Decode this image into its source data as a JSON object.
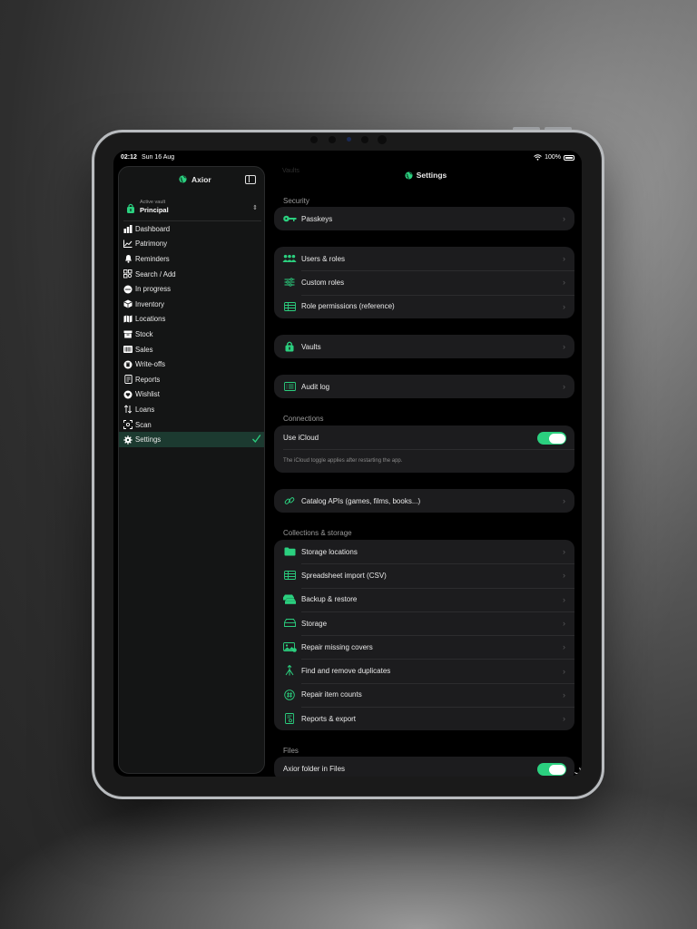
{
  "status_bar": {
    "time": "02:12",
    "date": "Sun 16 Aug",
    "battery": "100%"
  },
  "sidebar": {
    "app_title": "Axior",
    "active_vault_label": "Active vault",
    "active_vault_name": "Principal",
    "items": [
      {
        "label": "Dashboard",
        "icon": "bar-chart-icon"
      },
      {
        "label": "Patrimony",
        "icon": "trend-chart-icon"
      },
      {
        "label": "Reminders",
        "icon": "bell-icon"
      },
      {
        "label": "Search / Add",
        "icon": "grid-search-icon"
      },
      {
        "label": "In progress",
        "icon": "progress-dots-icon"
      },
      {
        "label": "Inventory",
        "icon": "cube-icon"
      },
      {
        "label": "Locations",
        "icon": "map-icon"
      },
      {
        "label": "Stock",
        "icon": "archive-box-icon"
      },
      {
        "label": "Sales",
        "icon": "barcode-icon"
      },
      {
        "label": "Write-offs",
        "icon": "trash-circle-icon"
      },
      {
        "label": "Reports",
        "icon": "document-icon"
      },
      {
        "label": "Wishlist",
        "icon": "heart-circle-icon"
      },
      {
        "label": "Loans",
        "icon": "swap-arrows-icon"
      },
      {
        "label": "Scan",
        "icon": "scan-viewfinder-icon"
      },
      {
        "label": "Settings",
        "icon": "gear-icon",
        "active": true
      }
    ]
  },
  "main": {
    "ghost_title": "Vaults",
    "title": "Settings",
    "sections": {
      "security": "Security",
      "connections": "Connections",
      "collections": "Collections & storage",
      "files": "Files"
    },
    "rows": {
      "passkeys": "Passkeys",
      "users_roles": "Users & roles",
      "custom_roles": "Custom roles",
      "role_permissions": "Role permissions (reference)",
      "vaults": "Vaults",
      "audit_log": "Audit log",
      "use_icloud": "Use iCloud",
      "icloud_note": "The iCloud toggle applies after restarting the app.",
      "catalog_apis": "Catalog APIs (games, films, books...)",
      "storage_locations": "Storage locations",
      "spreadsheet_import": "Spreadsheet import (CSV)",
      "backup_restore": "Backup & restore",
      "storage": "Storage",
      "repair_covers": "Repair missing covers",
      "find_duplicates": "Find and remove duplicates",
      "repair_counts": "Repair item counts",
      "reports_export": "Reports & export",
      "axior_folder": "Axior folder in Files"
    },
    "chevron": "›",
    "toggles": {
      "use_icloud": true,
      "axior_folder": true
    }
  },
  "colors": {
    "accent": "#2bd07f",
    "background": "#000000",
    "card": "#1c1c1e",
    "sidebar_active": "#1c3a30"
  }
}
